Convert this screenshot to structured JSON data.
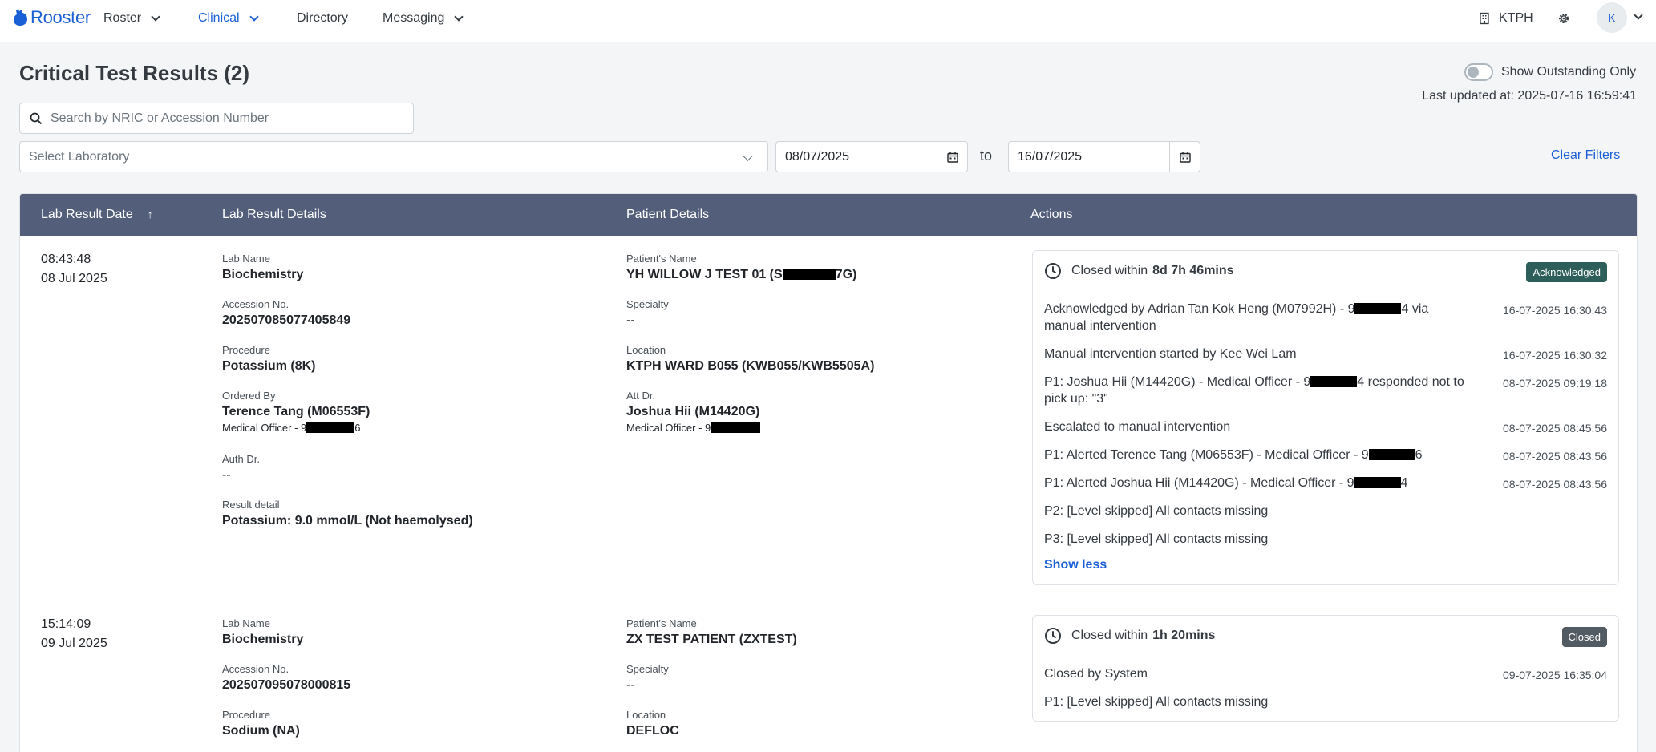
{
  "app": {
    "brand": "Rooster"
  },
  "nav": {
    "items": [
      {
        "label": "Roster",
        "has_dropdown": true,
        "active": false
      },
      {
        "label": "Clinical",
        "has_dropdown": true,
        "active": true
      },
      {
        "label": "Directory",
        "has_dropdown": false,
        "active": false
      },
      {
        "label": "Messaging",
        "has_dropdown": true,
        "active": false
      }
    ],
    "institution": "KTPH",
    "avatar_initial": "K"
  },
  "page": {
    "title": "Critical Test Results (2)",
    "toggle_label": "Show Outstanding Only",
    "toggle_on": false,
    "last_updated": "Last updated at: 2025-07-16 16:59:41"
  },
  "filters": {
    "search_placeholder": "Search by NRIC or Accession Number",
    "lab_placeholder": "Select Laboratory",
    "date_from": "08/07/2025",
    "to_label": "to",
    "date_to": "16/07/2025",
    "clear_label": "Clear Filters"
  },
  "table": {
    "headers": [
      "Lab Result Date",
      "Lab Result Details",
      "Patient Details",
      "Actions"
    ],
    "labels": {
      "lab_name": "Lab Name",
      "accession": "Accession No.",
      "procedure": "Procedure",
      "ordered_by": "Ordered By",
      "auth_dr": "Auth Dr.",
      "result_detail": "Result detail",
      "patient_name": "Patient's Name",
      "specialty": "Specialty",
      "location": "Location",
      "att_dr": "Att Dr."
    },
    "rows": [
      {
        "time": "08:43:48",
        "date": "08 Jul 2025",
        "lab_name": "Biochemistry",
        "accession": "202507085077405849",
        "procedure": "Potassium (8K)",
        "ordered_by": "Terence Tang (M06553F)",
        "ordered_by_sub_a": "Medical Officer - 9",
        "ordered_by_sub_b": "6",
        "auth_dr": "--",
        "result_detail": "Potassium: 9.0 mmol/L (Not haemolysed)",
        "patient_name_a": "YH WILLOW J TEST 01 (S",
        "patient_name_b": "7G)",
        "specialty": "--",
        "location": "KTPH WARD B055 (KWB055/KWB5505A)",
        "att_dr": "Joshua Hii (M14420G)",
        "att_dr_sub": "Medical Officer - 9",
        "status": {
          "closed_prefix": "Closed within",
          "closed_duration": "8d 7h 46mins",
          "badge": "Acknowledged",
          "badge_color": "#2e5e5a"
        },
        "logs": [
          {
            "a": "Acknowledged by Adrian Tan Kok Heng (M07992H) - 9",
            "b": "4 via",
            "c": "manual intervention",
            "time": "16-07-2025 16:30:43"
          },
          {
            "a": "Manual intervention started by Kee Wei Lam",
            "time": "16-07-2025 16:30:32"
          },
          {
            "a": "P1: Joshua Hii (M14420G) - Medical Officer - 9",
            "b": "4 responded not to",
            "c": "pick up: \"3\"",
            "time": "08-07-2025 09:19:18"
          },
          {
            "a": "Escalated to manual intervention",
            "time": "08-07-2025 08:45:56"
          },
          {
            "a": "P1: Alerted Terence Tang (M06553F) - Medical Officer - 9",
            "b": "6",
            "time": "08-07-2025 08:43:56"
          },
          {
            "a": "P1: Alerted Joshua Hii (M14420G) - Medical Officer - 9",
            "b": "4",
            "time": "08-07-2025 08:43:56"
          },
          {
            "a": "P2: [Level skipped] All contacts missing"
          },
          {
            "a": "P3: [Level skipped] All contacts missing"
          }
        ],
        "show_less": "Show less"
      },
      {
        "time": "15:14:09",
        "date": "09 Jul 2025",
        "lab_name": "Biochemistry",
        "accession": "202507095078000815",
        "procedure": "Sodium (NA)",
        "patient_name": "ZX TEST PATIENT (ZXTEST)",
        "specialty": "--",
        "location": "DEFLOC",
        "status": {
          "closed_prefix": "Closed within",
          "closed_duration": "1h 20mins",
          "badge": "Closed",
          "badge_color": "#525a62"
        },
        "logs": [
          {
            "a": "Closed by System",
            "time": "09-07-2025 16:35:04"
          },
          {
            "a": "P1: [Level skipped] All contacts missing"
          }
        ]
      }
    ]
  }
}
